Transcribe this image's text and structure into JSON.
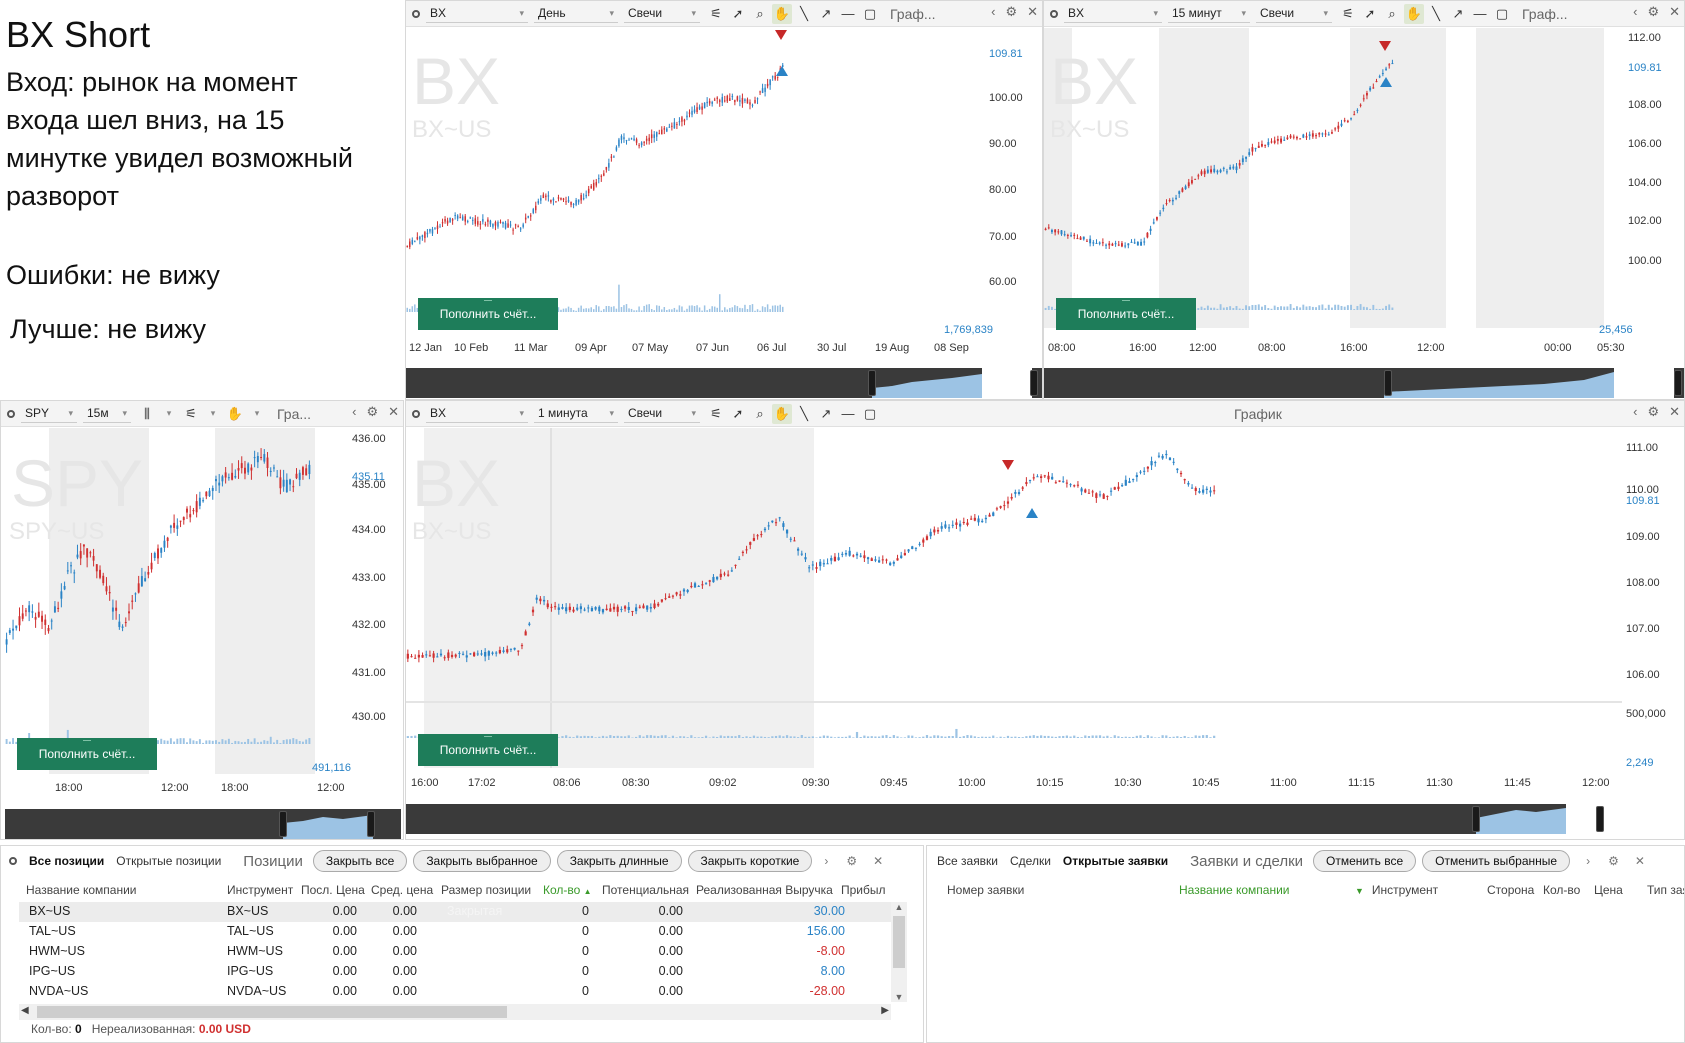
{
  "notes": {
    "title": "BX Short",
    "lines": [
      "Вход: рынок на момент",
      "входа шел вниз, на 15",
      "минутке увидел возможный",
      "разворот",
      "Ошибки: не вижу",
      "Лучше: не вижу"
    ]
  },
  "chart_daily": {
    "symbol": "BX",
    "interval": "День",
    "chart_type": "Свечи",
    "title": "Граф...",
    "watermark": "BX",
    "watermark_sub": "BX~US",
    "last_price": "109.81",
    "y_ticks": [
      "100.00",
      "90.00",
      "80.00",
      "70.00",
      "60.00"
    ],
    "volume_label": "1,769,839",
    "x_ticks": [
      "12 Jan",
      "10 Feb",
      "11 Mar",
      "09 Apr",
      "07 May",
      "07 Jun",
      "06 Jul",
      "30 Jul",
      "19 Aug",
      "08 Sep"
    ],
    "deposit_button": "Пополнить счёт..."
  },
  "chart_15m": {
    "symbol": "BX",
    "interval": "15 минут",
    "chart_type": "Свечи",
    "title": "Граф...",
    "watermark": "BX",
    "watermark_sub": "BX~US",
    "last_price": "109.81",
    "y_ticks": [
      "112.00",
      "110.00",
      "108.00",
      "106.00",
      "104.00",
      "102.00",
      "100.00"
    ],
    "volume_label": "25,456",
    "x_ticks": [
      "08:00",
      "16:00",
      "12:00",
      "08:00",
      "16:00",
      "12:00",
      "00:00",
      "05:30"
    ],
    "deposit_button": "Пополнить счёт..."
  },
  "chart_spy": {
    "symbol": "SPY",
    "interval": "15м",
    "title": "Гра...",
    "watermark": "SPY",
    "watermark_sub": "SPY~US",
    "last_price": "435.11",
    "y_ticks": [
      "436.00",
      "435.00",
      "434.00",
      "433.00",
      "432.00",
      "431.00",
      "430.00"
    ],
    "volume_label": "491,116",
    "x_ticks": [
      "18:00",
      "12:00",
      "18:00",
      "12:00"
    ],
    "deposit_button": "Пополнить счёт..."
  },
  "chart_1m": {
    "symbol": "BX",
    "interval": "1 минута",
    "chart_type": "Свечи",
    "title": "График",
    "watermark": "BX",
    "watermark_sub": "BX~US",
    "last_price": "109.81",
    "y_ticks": [
      "111.00",
      "110.00",
      "109.00",
      "108.00",
      "107.00",
      "106.00"
    ],
    "volume_ticks": [
      "500,000",
      "2,249"
    ],
    "x_ticks": [
      "16:00",
      "17:02",
      "08:06",
      "08:30",
      "09:02",
      "09:30",
      "09:45",
      "10:00",
      "10:15",
      "10:30",
      "10:45",
      "11:00",
      "11:15",
      "11:30",
      "11:45",
      "12:00"
    ],
    "deposit_button": "Пополнить счёт..."
  },
  "positions": {
    "tabs": [
      "Все позиции",
      "Открытые позиции"
    ],
    "title": "Позиции",
    "buttons": [
      "Закрыть все",
      "Закрыть выбранное",
      "Закрыть длинные",
      "Закрыть короткие"
    ],
    "columns": [
      "Название компании",
      "Инструмент",
      "Посл. Цена",
      "Сред. цена",
      "Размер позиции",
      "Кол-во",
      "Потенциальная",
      "Реализованная Выручка",
      "Прибыл"
    ],
    "rows": [
      {
        "company": "BX~US",
        "instrument": "BX~US",
        "last": "0.00",
        "avg": "0.00",
        "size": "Закрытая",
        "qty": "0",
        "potential": "0.00",
        "realized": "30.00"
      },
      {
        "company": "TAL~US",
        "instrument": "TAL~US",
        "last": "0.00",
        "avg": "0.00",
        "size": "",
        "qty": "0",
        "potential": "0.00",
        "realized": "156.00"
      },
      {
        "company": "HWM~US",
        "instrument": "HWM~US",
        "last": "0.00",
        "avg": "0.00",
        "size": "",
        "qty": "0",
        "potential": "0.00",
        "realized": "-8.00"
      },
      {
        "company": "IPG~US",
        "instrument": "IPG~US",
        "last": "0.00",
        "avg": "0.00",
        "size": "",
        "qty": "0",
        "potential": "0.00",
        "realized": "8.00"
      },
      {
        "company": "NVDA~US",
        "instrument": "NVDA~US",
        "last": "0.00",
        "avg": "0.00",
        "size": "",
        "qty": "0",
        "potential": "0.00",
        "realized": "-28.00"
      }
    ],
    "footer_qty_label": "Кол-во:",
    "footer_qty": "0",
    "footer_unreal_label": "Нереализованная:",
    "footer_unreal": "0.00 USD"
  },
  "orders": {
    "tabs": [
      "Все заявки",
      "Сделки",
      "Открытые заявки"
    ],
    "title": "Заявки и сделки",
    "buttons": [
      "Отменить все",
      "Отменить выбранные"
    ],
    "columns": [
      "Номер заявки",
      "Название компании",
      "Инструмент",
      "Сторона",
      "Кол-во",
      "Цена",
      "Тип заявки"
    ]
  },
  "colors": {
    "up": "#2a83c6",
    "down": "#d03030",
    "deposit": "#1e7d5a",
    "navigator": "#3a3a3a",
    "volume": "#9cc3e4"
  }
}
